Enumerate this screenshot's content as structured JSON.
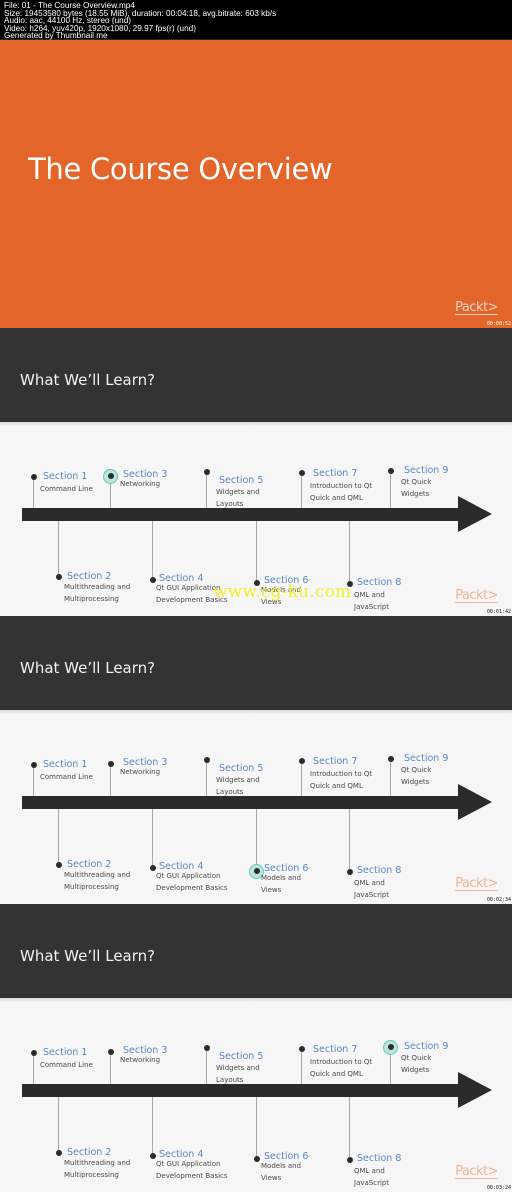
{
  "info_header": {
    "lines": [
      "File: 01 - The Course Overview.mp4",
      "Size: 19453580 bytes (18.55 MiB), duration: 00:04:18, avg.bitrate: 603 kb/s",
      "Audio: aac, 44100 Hz, stereo (und)",
      "Video: h264, yuv420p, 1920x1080, 29.97 fps(r) (und)",
      "Generated by Thumbnail me"
    ]
  },
  "colors": {
    "title_slide_bg": "#e4652a",
    "band_bg": "#333333",
    "section_label": "#5b86c5",
    "highlight_halo": "#b8e6dc",
    "watermark": "#f3f02a"
  },
  "brand": "Packt>",
  "title_slide": {
    "title": "The Course Overview",
    "timestamp": "00:00:52"
  },
  "timeline_title": "What We’ll Learn?",
  "sections": [
    {
      "label": "Section 1",
      "desc": [
        "Command Line"
      ]
    },
    {
      "label": "Section 2",
      "desc": [
        "Multithreading and",
        "Multiprocessing"
      ]
    },
    {
      "label": "Section 3",
      "desc": [
        "Networking"
      ]
    },
    {
      "label": "Section 4",
      "desc": [
        "Qt GUI Application",
        "Development Basics"
      ]
    },
    {
      "label": "Section 5",
      "desc": [
        "Widgets and",
        "Layouts"
      ]
    },
    {
      "label": "Section 6",
      "desc": [
        "Models and",
        "Views"
      ]
    },
    {
      "label": "Section 7",
      "desc": [
        "Introduction to Qt",
        "Quick and QML"
      ]
    },
    {
      "label": "Section 8",
      "desc": [
        "QML and",
        "JavaScript"
      ]
    },
    {
      "label": "Section 9",
      "desc": [
        "Qt Quick",
        "Widgets"
      ]
    }
  ],
  "timeline_slides": [
    {
      "timestamp": "00:01:42",
      "highlighted_section": "Section 3"
    },
    {
      "timestamp": "00:02:34",
      "highlighted_section": "Section 6"
    },
    {
      "timestamp": "00:03:24",
      "highlighted_section": "Section 9"
    }
  ],
  "watermark": "www.cg-ku.com"
}
